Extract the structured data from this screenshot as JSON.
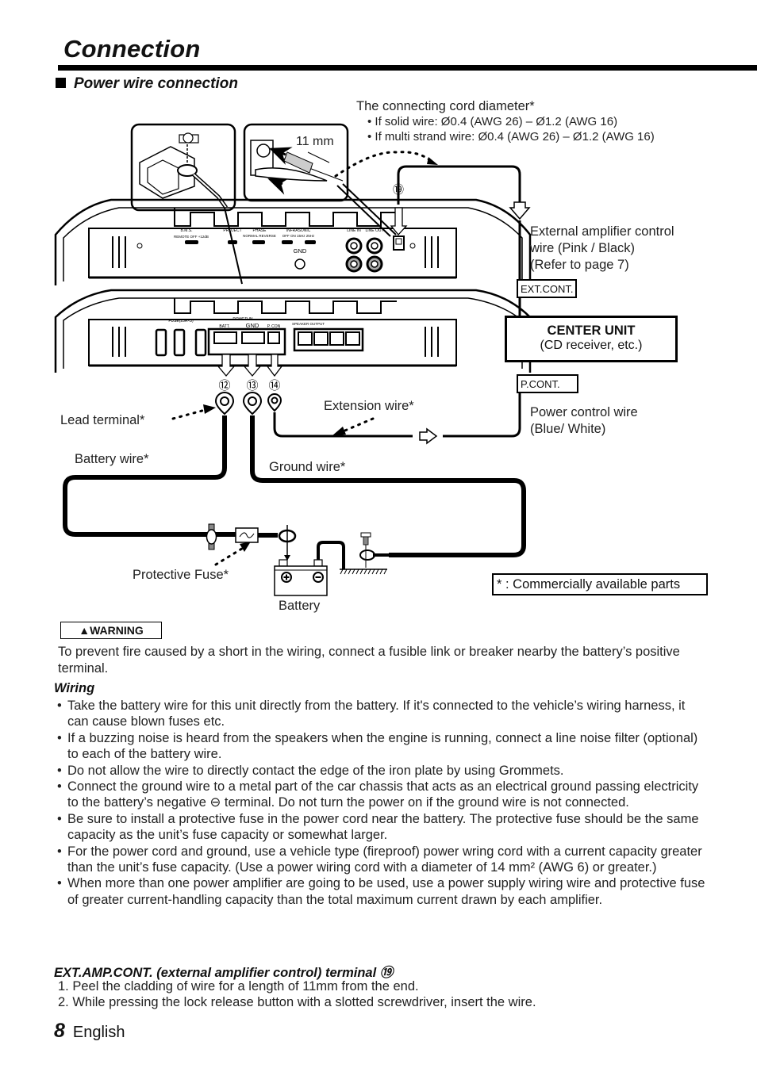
{
  "page": {
    "title": "Connection",
    "section_title": "Power wire connection",
    "page_number": "8",
    "language": "English"
  },
  "diagram": {
    "cord_diameter": {
      "heading": "The connecting cord diameter*",
      "bullets": [
        "• If solid wire: Ø0.4 (AWG 26) – Ø1.2 (AWG 16)",
        "• If multi strand wire: Ø0.4 (AWG 26) – Ø1.2 (AWG 16)"
      ]
    },
    "strip_length": "11 mm",
    "terminal_numbers": {
      "batt": "⑫",
      "gnd": "⑬",
      "pcon": "⑭",
      "ext": "⑲"
    },
    "amp_top_panel": {
      "bms": "B.M.S.",
      "bms_opts": "REMOTE  OFF  +12dB",
      "subsonic": "PROJECT",
      "phase": "PHASE",
      "phase_opts": "NORMAL  REVERSE",
      "infrasonic": "INFRASONIC",
      "infrasonic_opts": "OFF  ON   15Hz  25Hz",
      "gnd": "GND",
      "line_in": "LINE IN",
      "line_out": "LINE OUT"
    },
    "amp_bottom_panel": {
      "fuse": "FUSE(25A×3)",
      "power_in": "POWER IN",
      "batt": "BATT.",
      "gnd": "GND",
      "pcon": "P. CON",
      "speaker_output": "SPEAKER OUTPUT"
    },
    "labels": {
      "ext_amp_wire": [
        "External amplifier control",
        "wire (Pink / Black)",
        "(Refer to page 7)"
      ],
      "ext_cont": "EXT.CONT.",
      "center_unit_title": "CENTER UNIT",
      "center_unit_sub": "(CD receiver, etc.)",
      "p_cont": "P.CONT.",
      "power_control_wire": [
        "Power control wire",
        "(Blue/ White)"
      ],
      "lead_terminal": "Lead terminal*",
      "extension_wire": "Extension wire*",
      "battery_wire": "Battery wire*",
      "ground_wire": "Ground wire*",
      "protective_fuse": "Protective Fuse*",
      "battery": "Battery",
      "commercial_note": "* : Commercially available parts"
    }
  },
  "warning": {
    "badge": "▲WARNING",
    "text": "To prevent fire caused by a short in the wiring, connect a fusible link or breaker nearby the battery’s positive terminal."
  },
  "wiring": {
    "heading": "Wiring",
    "items": [
      "Take the battery wire for this unit directly from the battery. If it's connected to the vehicle’s wiring harness, it can cause blown fuses etc.",
      "If a buzzing noise is heard from the speakers when the engine is running, connect a line noise filter (optional) to each of the battery wire.",
      "Do not allow the wire to directly contact the edge of the iron plate by using Grommets.",
      "Connect the ground wire to a metal part of the car chassis that acts as an electrical ground passing electricity to the battery’s negative ⊖ terminal. Do not turn the power on if the ground wire is not connected.",
      "Be sure to install a protective fuse in the power cord near the battery. The protective fuse should be the same capacity as the unit’s fuse capacity or somewhat larger.",
      "For the power cord and ground, use a vehicle type (fireproof) power wring cord with a current capacity greater than the unit’s fuse capacity. (Use a power wiring cord with a diameter of 14 mm² (AWG 6) or greater.)",
      "When more than one power amplifier are going to be used, use a power supply wiring wire and protective fuse of greater current-handling capacity than the total maximum current drawn by each amplifier."
    ]
  },
  "ext_amp_cont": {
    "heading": "EXT.AMP.CONT. (external amplifier control) terminal ⑲",
    "steps": [
      "1. Peel the cladding of wire for a length of 11mm from the end.",
      "2. While pressing the lock release button with a slotted screwdriver, insert the wire."
    ]
  }
}
